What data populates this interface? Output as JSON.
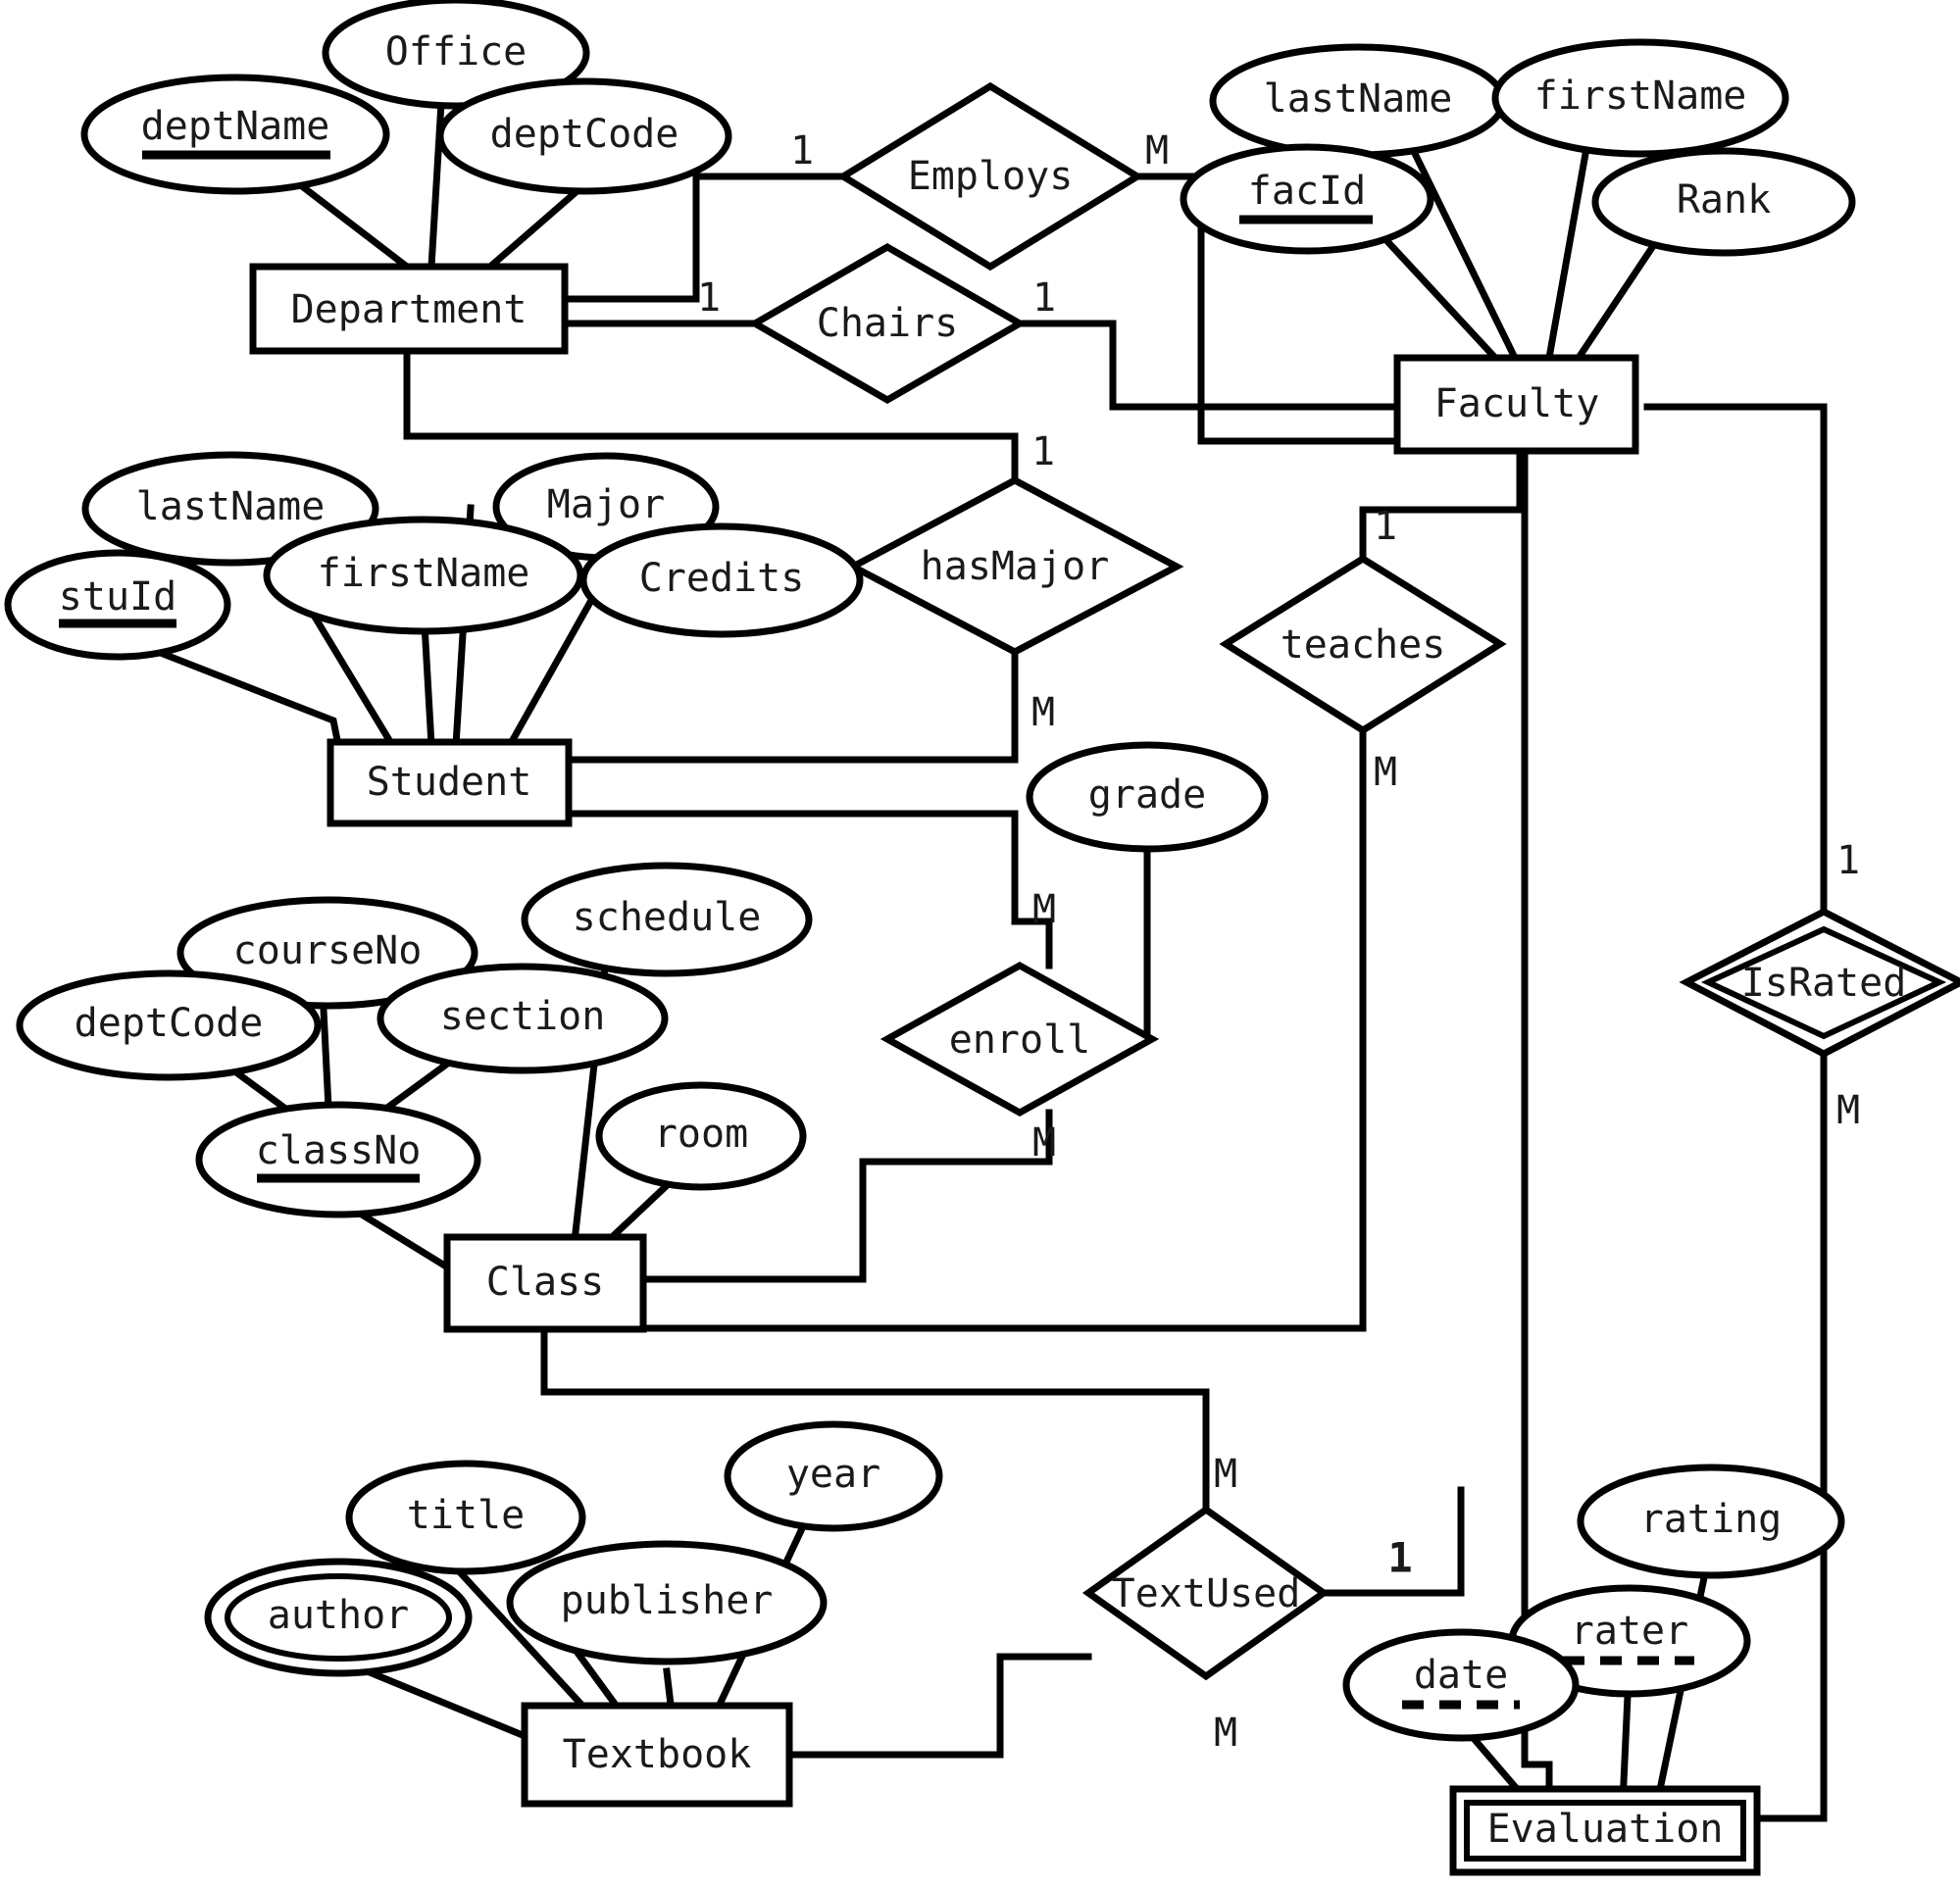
{
  "diagram": {
    "title": "University ER Diagram",
    "notation": "Chen ER",
    "stroke_color": "#000000",
    "fill_color": "#ffffff",
    "text_color": "#1a1a1a"
  },
  "entities": [
    {
      "id": "department",
      "label": "Department",
      "weak": false
    },
    {
      "id": "faculty",
      "label": "Faculty",
      "weak": false
    },
    {
      "id": "student",
      "label": "Student",
      "weak": false
    },
    {
      "id": "class",
      "label": "Class",
      "weak": false
    },
    {
      "id": "textbook",
      "label": "Textbook",
      "weak": false
    },
    {
      "id": "evaluation",
      "label": "Evaluation",
      "weak": true
    }
  ],
  "attributes": [
    {
      "id": "dept-deptname",
      "label": "deptName",
      "key": "primary",
      "owner": "Department"
    },
    {
      "id": "dept-office",
      "label": "Office",
      "key": "none",
      "owner": "Department"
    },
    {
      "id": "dept-deptcode",
      "label": "deptCode",
      "key": "none",
      "owner": "Department"
    },
    {
      "id": "fac-lastname",
      "label": "lastName",
      "key": "none",
      "owner": "Faculty"
    },
    {
      "id": "fac-firstname",
      "label": "firstName",
      "key": "none",
      "owner": "Faculty"
    },
    {
      "id": "fac-facid",
      "label": "facId",
      "key": "primary",
      "owner": "Faculty"
    },
    {
      "id": "fac-rank",
      "label": "Rank",
      "key": "none",
      "owner": "Faculty"
    },
    {
      "id": "stu-lastname",
      "label": "lastName",
      "key": "none",
      "owner": "Student"
    },
    {
      "id": "stu-firstname",
      "label": "firstName",
      "key": "none",
      "owner": "Student"
    },
    {
      "id": "stu-stuid",
      "label": "stuId",
      "key": "primary",
      "owner": "Student"
    },
    {
      "id": "stu-major",
      "label": "Major",
      "key": "none",
      "owner": "Student"
    },
    {
      "id": "stu-credits",
      "label": "Credits",
      "key": "none",
      "owner": "Student"
    },
    {
      "id": "cls-deptcode",
      "label": "deptCode",
      "key": "none",
      "owner": "Class"
    },
    {
      "id": "cls-courseno",
      "label": "courseNo",
      "key": "none",
      "owner": "Class"
    },
    {
      "id": "cls-section",
      "label": "section",
      "key": "none",
      "owner": "Class"
    },
    {
      "id": "cls-schedule",
      "label": "schedule",
      "key": "none",
      "owner": "Class"
    },
    {
      "id": "cls-room",
      "label": "room",
      "key": "none",
      "owner": "Class"
    },
    {
      "id": "cls-classno",
      "label": "classNo",
      "key": "primary",
      "owner": "Class"
    },
    {
      "id": "txt-author",
      "label": "author",
      "key": "multivalued",
      "owner": "Textbook"
    },
    {
      "id": "txt-title",
      "label": "title",
      "key": "none",
      "owner": "Textbook"
    },
    {
      "id": "txt-publisher",
      "label": "publisher",
      "key": "none",
      "owner": "Textbook"
    },
    {
      "id": "txt-year",
      "label": "year",
      "key": "none",
      "owner": "Textbook"
    },
    {
      "id": "eval-date",
      "label": "date",
      "key": "partial",
      "owner": "Evaluation"
    },
    {
      "id": "eval-rater",
      "label": "rater",
      "key": "partial",
      "owner": "Evaluation"
    },
    {
      "id": "eval-rating",
      "label": "rating",
      "key": "none",
      "owner": "Evaluation"
    },
    {
      "id": "enroll-grade",
      "label": "grade",
      "key": "none",
      "owner": "enroll"
    }
  ],
  "relationships": [
    {
      "id": "employs",
      "label": "Employs",
      "identifying": false,
      "from": "Department",
      "to": "Faculty",
      "from_card": "1",
      "to_card": "M"
    },
    {
      "id": "chairs",
      "label": "Chairs",
      "identifying": false,
      "from": "Department",
      "to": "Faculty",
      "from_card": "1",
      "to_card": "1"
    },
    {
      "id": "hasmajor",
      "label": "hasMajor",
      "identifying": false,
      "from": "Department",
      "to": "Student",
      "from_card": "1",
      "to_card": "M"
    },
    {
      "id": "teaches",
      "label": "teaches",
      "identifying": false,
      "from": "Faculty",
      "to": "Class",
      "from_card": "1",
      "to_card": "M"
    },
    {
      "id": "enroll",
      "label": "enroll",
      "identifying": false,
      "from": "Student",
      "to": "Class",
      "from_card": "M",
      "to_card": "M"
    },
    {
      "id": "textused",
      "label": "TextUsed",
      "identifying": false,
      "from": "Class",
      "to": "Textbook",
      "from_card": "M",
      "to_card": "1"
    },
    {
      "id": "israted",
      "label": "IsRated",
      "identifying": true,
      "from": "Faculty",
      "to": "Evaluation",
      "from_card": "1",
      "to_card": "M"
    }
  ],
  "cardinality_labels": [
    {
      "id": "employs-left",
      "text": "1"
    },
    {
      "id": "employs-right",
      "text": "M"
    },
    {
      "id": "chairs-left",
      "text": "1"
    },
    {
      "id": "chairs-right",
      "text": "1"
    },
    {
      "id": "hasmajor-top",
      "text": "1"
    },
    {
      "id": "hasmajor-bottom",
      "text": "M"
    },
    {
      "id": "teaches-top",
      "text": "1"
    },
    {
      "id": "teaches-bottom",
      "text": "M"
    },
    {
      "id": "enroll-top",
      "text": "M"
    },
    {
      "id": "enroll-bottom",
      "text": "M"
    },
    {
      "id": "textused-top",
      "text": "M"
    },
    {
      "id": "textused-right",
      "text": "1"
    },
    {
      "id": "textused-bottom",
      "text": "M"
    },
    {
      "id": "israted-top",
      "text": "1"
    },
    {
      "id": "israted-bottom",
      "text": "M"
    }
  ]
}
